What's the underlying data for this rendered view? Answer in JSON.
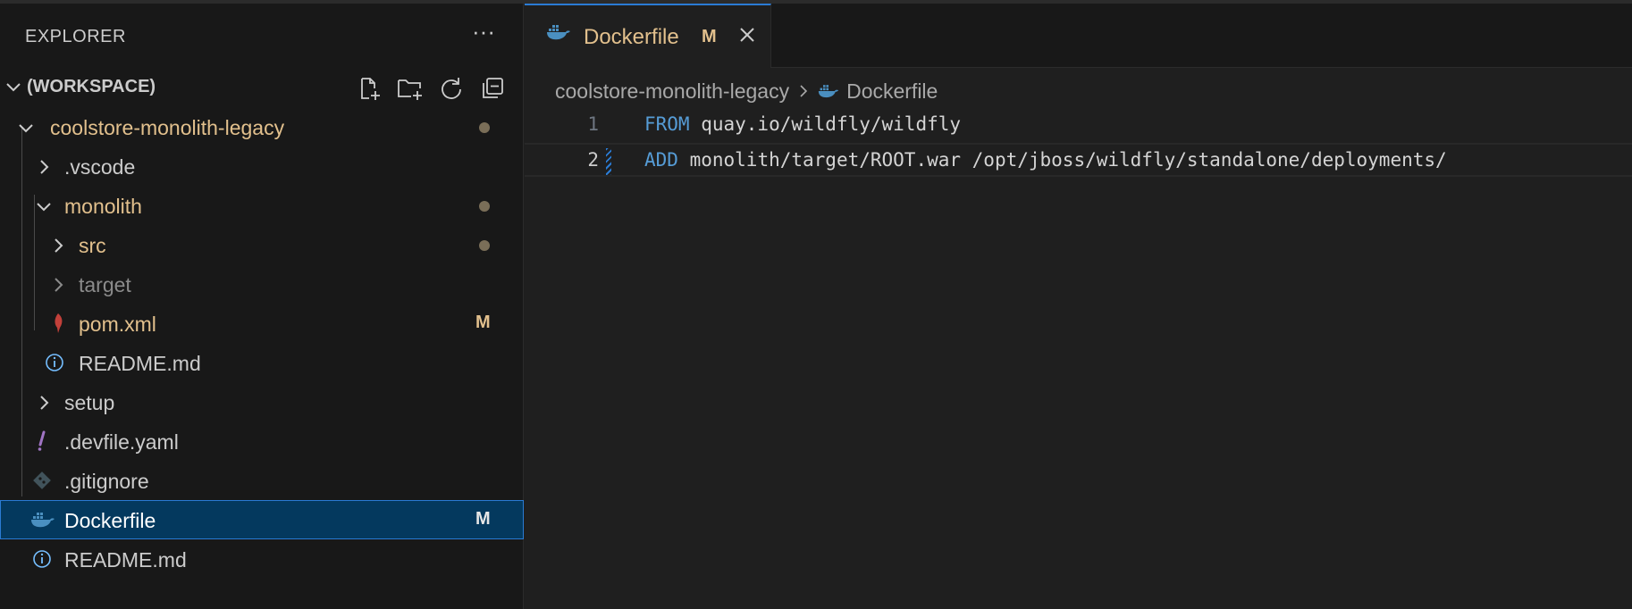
{
  "sidebar": {
    "title": "EXPLORER",
    "more_label": "···",
    "workspace": {
      "label": "(WORKSPACE)"
    },
    "tree": [
      {
        "label": "coolstore-monolith-legacy"
      },
      {
        "label": ".vscode"
      },
      {
        "label": "monolith"
      },
      {
        "label": "src"
      },
      {
        "label": "target"
      },
      {
        "label": "pom.xml",
        "badge": "M"
      },
      {
        "label": "README.md"
      },
      {
        "label": "setup"
      },
      {
        "label": ".devfile.yaml"
      },
      {
        "label": ".gitignore"
      },
      {
        "label": "Dockerfile",
        "badge": "M"
      },
      {
        "label": "README.md"
      }
    ]
  },
  "editor": {
    "tab": {
      "label": "Dockerfile",
      "badge": "M"
    },
    "breadcrumb": [
      "coolstore-monolith-legacy",
      "Dockerfile"
    ],
    "lines": [
      {
        "number": "1",
        "keyword": "FROM",
        "text": " quay.io/wildfly/wildfly"
      },
      {
        "number": "2",
        "keyword": "ADD",
        "text": " monolith/target/ROOT.war /opt/jboss/wildfly/standalone/deployments/"
      }
    ]
  },
  "colors": {
    "background": "#1f1f1f",
    "sidebar_background": "#181818",
    "modified": "#e2c08d",
    "selection": "#04395e",
    "focus_border": "#2a7bd4",
    "keyword": "#569cd6"
  }
}
